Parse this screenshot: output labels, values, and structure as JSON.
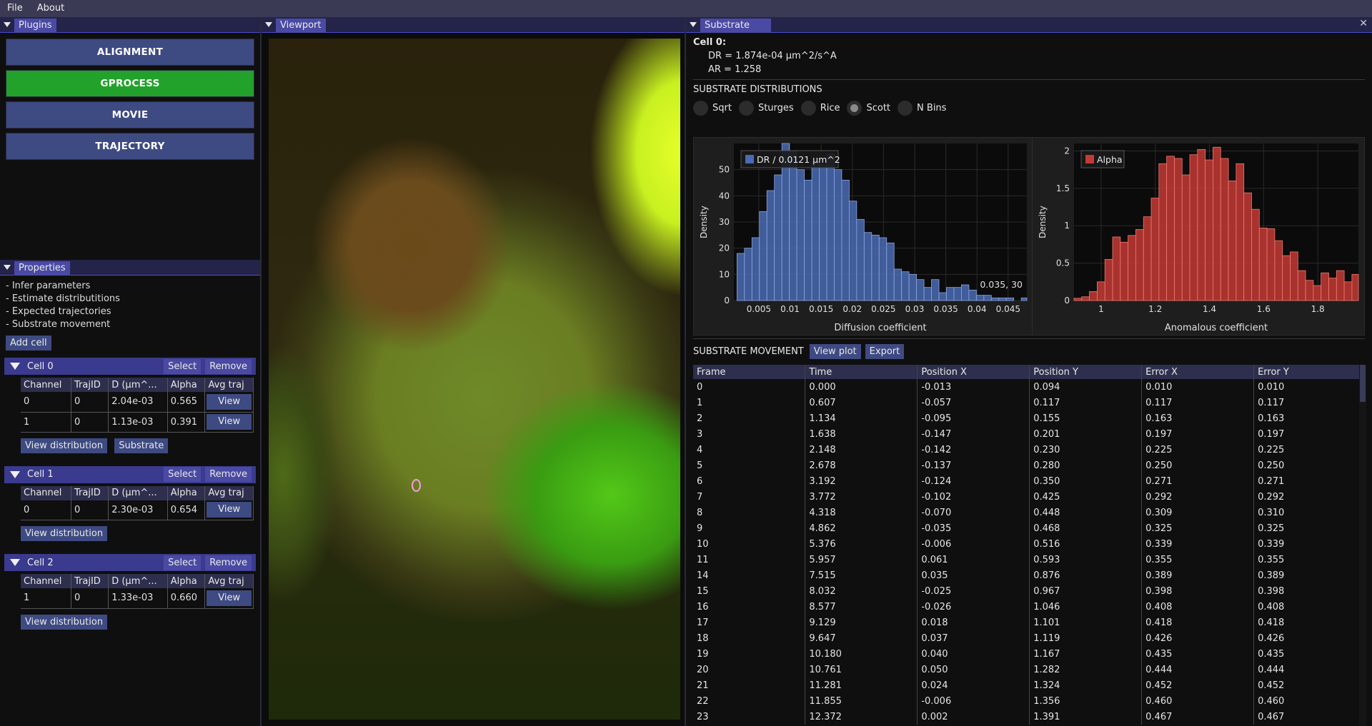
{
  "menubar": {
    "file": "File",
    "about": "About"
  },
  "plugins": {
    "title": "Plugins",
    "buttons": [
      "ALIGNMENT",
      "GPROCESS",
      "MOVIE",
      "TRAJECTORY"
    ],
    "active": "GPROCESS",
    "active_color": "#22a22a"
  },
  "properties": {
    "title": "Properties",
    "lines": [
      "- Infer parameters",
      "- Estimate distributitions",
      "- Expected trajectories",
      "- Substrate movement"
    ],
    "add_cell": "Add cell",
    "select_label": "Select",
    "remove_label": "Remove",
    "view_label": "View",
    "view_distribution": "View distribution",
    "substrate_label": "Substrate",
    "columns": [
      "Channel",
      "TrajID",
      "D (µm^...",
      "Alpha",
      "Avg traj"
    ],
    "cells": [
      {
        "name": "Cell 0",
        "rows": [
          [
            "0",
            "0",
            "2.04e-03",
            "0.565"
          ],
          [
            "1",
            "0",
            "1.13e-03",
            "0.391"
          ]
        ]
      },
      {
        "name": "Cell 1",
        "rows": [
          [
            "0",
            "0",
            "2.30e-03",
            "0.654"
          ]
        ]
      },
      {
        "name": "Cell 2",
        "rows": [
          [
            "1",
            "0",
            "1.33e-03",
            "0.660"
          ]
        ]
      }
    ]
  },
  "viewport": {
    "title": "Viewport"
  },
  "substrate": {
    "title": "Substrate",
    "close": "✕",
    "cell_label": "Cell 0:",
    "dr_line": "DR = 1.874e-04 µm^2/s^A",
    "ar_line": "AR = 1.258",
    "distributions_heading": "SUBSTRATE DISTRIBUTIONS",
    "radios": [
      "Sqrt",
      "Sturges",
      "Rice",
      "Scott",
      "N Bins"
    ],
    "radio_selected": "Scott",
    "movement_heading": "SUBSTRATE MOVEMENT",
    "view_plot": "View plot",
    "export": "Export",
    "table_columns": [
      "Frame",
      "Time",
      "Position X",
      "Position Y",
      "Error X",
      "Error Y"
    ],
    "table_rows": [
      [
        "0",
        "0.000",
        "-0.013",
        "0.094",
        "0.010",
        "0.010"
      ],
      [
        "1",
        "0.607",
        "-0.057",
        "0.117",
        "0.117",
        "0.117"
      ],
      [
        "2",
        "1.134",
        "-0.095",
        "0.155",
        "0.163",
        "0.163"
      ],
      [
        "3",
        "1.638",
        "-0.147",
        "0.201",
        "0.197",
        "0.197"
      ],
      [
        "4",
        "2.148",
        "-0.142",
        "0.230",
        "0.225",
        "0.225"
      ],
      [
        "5",
        "2.678",
        "-0.137",
        "0.280",
        "0.250",
        "0.250"
      ],
      [
        "6",
        "3.192",
        "-0.124",
        "0.350",
        "0.271",
        "0.271"
      ],
      [
        "7",
        "3.772",
        "-0.102",
        "0.425",
        "0.292",
        "0.292"
      ],
      [
        "8",
        "4.318",
        "-0.070",
        "0.448",
        "0.309",
        "0.310"
      ],
      [
        "9",
        "4.862",
        "-0.035",
        "0.468",
        "0.325",
        "0.325"
      ],
      [
        "10",
        "5.376",
        "-0.006",
        "0.516",
        "0.339",
        "0.339"
      ],
      [
        "11",
        "5.957",
        "0.061",
        "0.593",
        "0.355",
        "0.355"
      ],
      [
        "14",
        "7.515",
        "0.035",
        "0.876",
        "0.389",
        "0.389"
      ],
      [
        "15",
        "8.032",
        "-0.025",
        "0.967",
        "0.398",
        "0.398"
      ],
      [
        "16",
        "8.577",
        "-0.026",
        "1.046",
        "0.408",
        "0.408"
      ],
      [
        "17",
        "9.129",
        "0.018",
        "1.101",
        "0.418",
        "0.418"
      ],
      [
        "18",
        "9.647",
        "0.037",
        "1.119",
        "0.426",
        "0.426"
      ],
      [
        "19",
        "10.180",
        "0.040",
        "1.167",
        "0.435",
        "0.435"
      ],
      [
        "20",
        "10.761",
        "0.050",
        "1.282",
        "0.444",
        "0.444"
      ],
      [
        "21",
        "11.281",
        "0.024",
        "1.324",
        "0.452",
        "0.452"
      ],
      [
        "22",
        "11.855",
        "-0.006",
        "1.356",
        "0.460",
        "0.460"
      ],
      [
        "23",
        "12.372",
        "0.002",
        "1.391",
        "0.467",
        "0.467"
      ]
    ]
  },
  "chart_data": [
    {
      "type": "bar",
      "legend": "DR / 0.0121 µm^2",
      "color": "#4a6cb4",
      "xlabel": "Diffusion coefficient",
      "ylabel": "Density",
      "xlim": [
        0.001,
        0.048
      ],
      "ylim": [
        0,
        60
      ],
      "xticks": [
        "0.005",
        "0.01",
        "0.015",
        "0.02",
        "0.025",
        "0.03",
        "0.035",
        "0.04",
        "0.045"
      ],
      "xtick_values": [
        0.005,
        0.01,
        0.015,
        0.02,
        0.025,
        0.03,
        0.035,
        0.04,
        0.045
      ],
      "yticks": [
        0,
        10,
        20,
        30,
        40,
        50
      ],
      "bin_start": 0.0015,
      "bin_width": 0.0012,
      "values": [
        18,
        20,
        24,
        34,
        42,
        48,
        61,
        57,
        50,
        46,
        53,
        52,
        56,
        50,
        46,
        38,
        31,
        26,
        25,
        24,
        22,
        12,
        11,
        10,
        8,
        5,
        8,
        3,
        5,
        5,
        6,
        4,
        2,
        2,
        1,
        1,
        1,
        0,
        1
      ],
      "readout": "0.035, 30",
      "grid": true
    },
    {
      "type": "bar",
      "legend": "Alpha",
      "color": "#c43a34",
      "xlabel": "Anomalous coefficient",
      "ylabel": "Density",
      "xlim": [
        0.9,
        1.95
      ],
      "ylim": [
        0,
        2.1
      ],
      "xticks": [
        "1",
        "1.2",
        "1.4",
        "1.6",
        "1.8"
      ],
      "xtick_values": [
        1,
        1.2,
        1.4,
        1.6,
        1.8
      ],
      "yticks": [
        0,
        0.5,
        1,
        1.5,
        2
      ],
      "ytick_labels": [
        "0",
        "0.5",
        "1",
        "1.5",
        "2"
      ],
      "bin_start": 0.9,
      "bin_width": 0.0285,
      "values": [
        0.03,
        0.05,
        0.12,
        0.25,
        0.55,
        0.85,
        0.78,
        0.87,
        0.95,
        1.12,
        1.37,
        1.83,
        1.93,
        1.9,
        1.68,
        1.95,
        2.02,
        1.88,
        2.05,
        1.9,
        1.6,
        1.83,
        1.44,
        1.22,
        0.97,
        0.96,
        0.8,
        0.6,
        0.65,
        0.4,
        0.27,
        0.2,
        0.37,
        0.3,
        0.4,
        0.25,
        0.35,
        0.2,
        0.27,
        0.25,
        0.4
      ],
      "grid": true
    }
  ]
}
